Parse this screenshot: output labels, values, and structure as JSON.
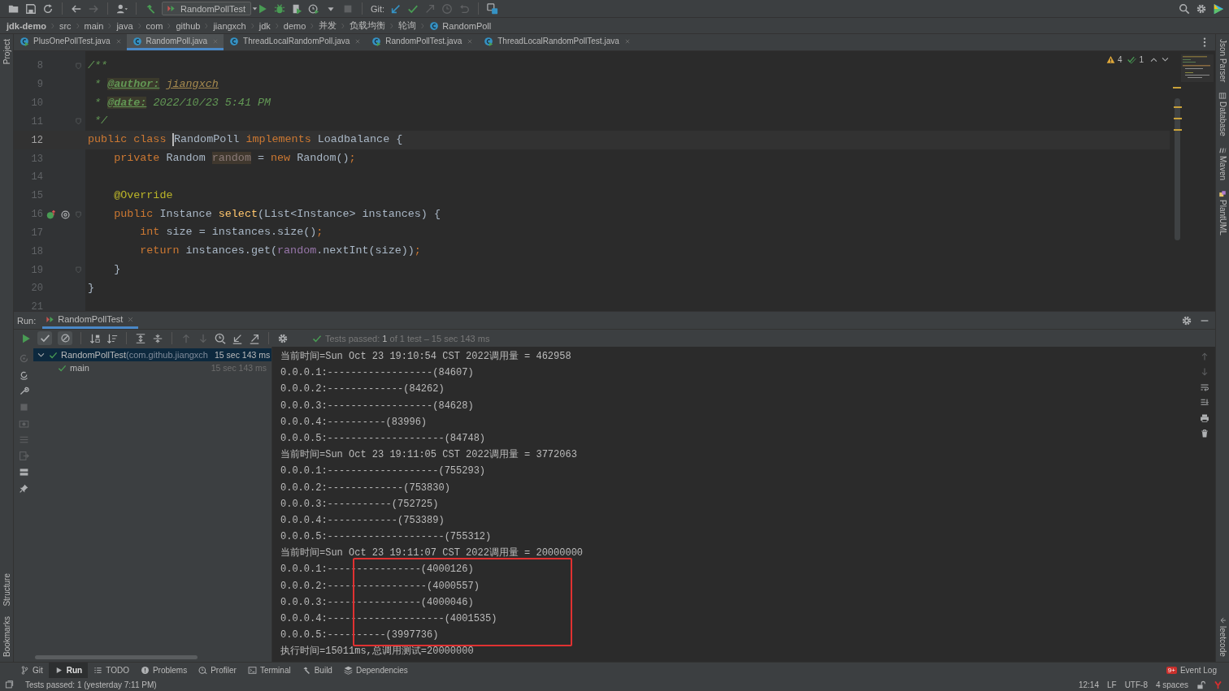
{
  "toolbar": {
    "run_config": "RandomPollTest",
    "git_label": "Git:"
  },
  "breadcrumbs": [
    {
      "label": "jdk-demo",
      "kind": "project"
    },
    {
      "label": "src",
      "kind": "dir"
    },
    {
      "label": "main",
      "kind": "dir"
    },
    {
      "label": "java",
      "kind": "dir"
    },
    {
      "label": "com",
      "kind": "dir"
    },
    {
      "label": "github",
      "kind": "dir"
    },
    {
      "label": "jiangxch",
      "kind": "dir"
    },
    {
      "label": "jdk",
      "kind": "dir"
    },
    {
      "label": "demo",
      "kind": "dir"
    },
    {
      "label": "并发",
      "kind": "dir"
    },
    {
      "label": "负载均衡",
      "kind": "dir"
    },
    {
      "label": "轮询",
      "kind": "dir"
    },
    {
      "label": "RandomPoll",
      "kind": "class"
    }
  ],
  "left_stripe": {
    "top": [
      "Project"
    ],
    "bottom": [
      "Structure",
      "Bookmarks"
    ]
  },
  "right_stripe": {
    "top": [
      "Json Parser",
      "Database",
      "Maven",
      "PlantUML"
    ],
    "bottom": [
      "leetcode"
    ]
  },
  "tabs": [
    {
      "label": "PlusOnePollTest.java",
      "kind": "test",
      "selected": false
    },
    {
      "label": "RandomPoll.java",
      "kind": "class",
      "selected": true
    },
    {
      "label": "ThreadLocalRandomPoll.java",
      "kind": "class",
      "selected": false
    },
    {
      "label": "RandomPollTest.java",
      "kind": "test",
      "selected": false
    },
    {
      "label": "ThreadLocalRandomPollTest.java",
      "kind": "test",
      "selected": false
    }
  ],
  "inspections": {
    "warnings": "4",
    "weak_warnings": "1"
  },
  "editor": {
    "lines": [
      {
        "n": "8",
        "fold": true,
        "current": false,
        "marks": false,
        "tokens": [
          {
            "t": "/**",
            "kind": "doc"
          }
        ]
      },
      {
        "n": "9",
        "fold": false,
        "current": false,
        "marks": false,
        "tokens": [
          {
            "t": " * ",
            "kind": "doc"
          },
          {
            "t": "@author:",
            "kind": "doctag"
          },
          {
            "t": " jiangxch",
            "kind": "docval"
          }
        ]
      },
      {
        "n": "10",
        "fold": false,
        "current": false,
        "marks": false,
        "tokens": [
          {
            "t": " * ",
            "kind": "doc"
          },
          {
            "t": "@date:",
            "kind": "doctag"
          },
          {
            "t": " 2022/10/23 5:41 PM",
            "kind": "doc"
          }
        ]
      },
      {
        "n": "11",
        "fold": true,
        "current": false,
        "marks": false,
        "tokens": [
          {
            "t": " */",
            "kind": "doc"
          }
        ]
      },
      {
        "n": "12",
        "fold": false,
        "current": true,
        "marks": false,
        "tokens": [
          {
            "t": "public class ",
            "kind": "kw"
          },
          {
            "t": "RandomPoll",
            "kind": "plain",
            "caret": true
          },
          {
            "t": " implements ",
            "kind": "kw"
          },
          {
            "t": "Loadbalance {",
            "kind": "plain"
          }
        ]
      },
      {
        "n": "13",
        "fold": false,
        "current": false,
        "marks": false,
        "tokens": [
          {
            "t": "    private ",
            "kind": "kw"
          },
          {
            "t": "Random ",
            "kind": "plain"
          },
          {
            "t": "random",
            "kind": "unused"
          },
          {
            "t": " = ",
            "kind": "plain"
          },
          {
            "t": "new ",
            "kind": "kw"
          },
          {
            "t": "Random()",
            "kind": "plain"
          },
          {
            "t": ";",
            "kind": "kw"
          }
        ]
      },
      {
        "n": "14",
        "fold": false,
        "current": false,
        "marks": false
      },
      {
        "n": "15",
        "fold": false,
        "current": false,
        "marks": false,
        "tokens": [
          {
            "t": "    @Override",
            "kind": "ann"
          }
        ]
      },
      {
        "n": "16",
        "fold": true,
        "current": false,
        "marks": true,
        "tokens": [
          {
            "t": "    public ",
            "kind": "kw"
          },
          {
            "t": "Instance ",
            "kind": "plain"
          },
          {
            "t": "select",
            "kind": "fn"
          },
          {
            "t": "(List<Instance> instances) {",
            "kind": "plain"
          }
        ]
      },
      {
        "n": "17",
        "fold": false,
        "current": false,
        "marks": false,
        "tokens": [
          {
            "t": "        int ",
            "kind": "kw"
          },
          {
            "t": "size = instances.size()",
            "kind": "plain"
          },
          {
            "t": ";",
            "kind": "kw"
          }
        ]
      },
      {
        "n": "18",
        "fold": false,
        "current": false,
        "marks": false,
        "tokens": [
          {
            "t": "        return ",
            "kind": "kw"
          },
          {
            "t": "instances.get(",
            "kind": "plain"
          },
          {
            "t": "random",
            "kind": "field"
          },
          {
            "t": ".nextInt(size))",
            "kind": "plain"
          },
          {
            "t": ";",
            "kind": "kw"
          }
        ]
      },
      {
        "n": "19",
        "fold": true,
        "current": false,
        "marks": false,
        "tokens": [
          {
            "t": "    }",
            "kind": "plain"
          }
        ]
      },
      {
        "n": "20",
        "fold": false,
        "current": false,
        "marks": false,
        "tokens": [
          {
            "t": "}",
            "kind": "plain"
          }
        ]
      },
      {
        "n": "21",
        "fold": false,
        "current": false,
        "marks": false
      }
    ]
  },
  "run": {
    "label": "Run:",
    "tab": "RandomPollTest",
    "status": "Tests passed: **1** of 1 test – 15 sec 143 ms",
    "tree": [
      {
        "name": "RandomPollTest",
        "package": "(com.github.jiangxch",
        "time": "15 sec 143 ms",
        "selected": true,
        "expanded": true,
        "children": [
          {
            "name": "main",
            "time": "15 sec 143 ms",
            "selected": false
          }
        ]
      }
    ],
    "console": [
      {
        "text": "当前时间=Sun Oct 23 19:10:54 CST 2022调用量 = 462958",
        "marked": false
      },
      {
        "text": "0.0.0.1:------------------(84607)",
        "marked": false
      },
      {
        "text": "0.0.0.2:-------------(84262)",
        "marked": false
      },
      {
        "text": "0.0.0.3:------------------(84628)",
        "marked": false
      },
      {
        "text": "0.0.0.4:----------(83996)",
        "marked": false
      },
      {
        "text": "0.0.0.5:--------------------(84748)",
        "marked": false
      },
      {
        "text": "当前时间=Sun Oct 23 19:11:05 CST 2022调用量 = 3772063",
        "marked": false
      },
      {
        "text": "0.0.0.1:-------------------(755293)",
        "marked": false
      },
      {
        "text": "0.0.0.2:-------------(753830)",
        "marked": false
      },
      {
        "text": "0.0.0.3:-----------(752725)",
        "marked": false
      },
      {
        "text": "0.0.0.4:------------(753389)",
        "marked": false
      },
      {
        "text": "0.0.0.5:--------------------(755312)",
        "marked": false
      },
      {
        "text": "当前时间=Sun Oct 23 19:11:07 CST 2022调用量 = 20000000",
        "marked": false
      },
      {
        "text": "0.0.0.1:----------------(4000126)",
        "marked": true
      },
      {
        "text": "0.0.0.2:-----------------(4000557)",
        "marked": true
      },
      {
        "text": "0.0.0.3:----------------(4000046)",
        "marked": true
      },
      {
        "text": "0.0.0.4:--------------------(4001535)",
        "marked": true
      },
      {
        "text": "0.0.0.5:----------(3997736)",
        "marked": true
      },
      {
        "text": "执行时间=15011ms,总调用测试=20000000",
        "marked": false
      }
    ]
  },
  "tool_windows": [
    {
      "label": "Git",
      "kind": "git",
      "selected": false
    },
    {
      "label": "Run",
      "kind": "run",
      "selected": true
    },
    {
      "label": "TODO",
      "kind": "todo",
      "selected": false
    },
    {
      "label": "Problems",
      "kind": "problems",
      "selected": false
    },
    {
      "label": "Profiler",
      "kind": "profiler",
      "selected": false
    },
    {
      "label": "Terminal",
      "kind": "terminal",
      "selected": false
    },
    {
      "label": "Build",
      "kind": "build",
      "selected": false
    },
    {
      "label": "Dependencies",
      "kind": "deps",
      "selected": false
    }
  ],
  "event_log": {
    "label": "Event Log",
    "badge": "9+"
  },
  "status_bar": {
    "message": "Tests passed: 1 (yesterday 7:11 PM)",
    "items": [
      "12:14",
      "LF",
      "UTF-8",
      "4 spaces"
    ]
  }
}
